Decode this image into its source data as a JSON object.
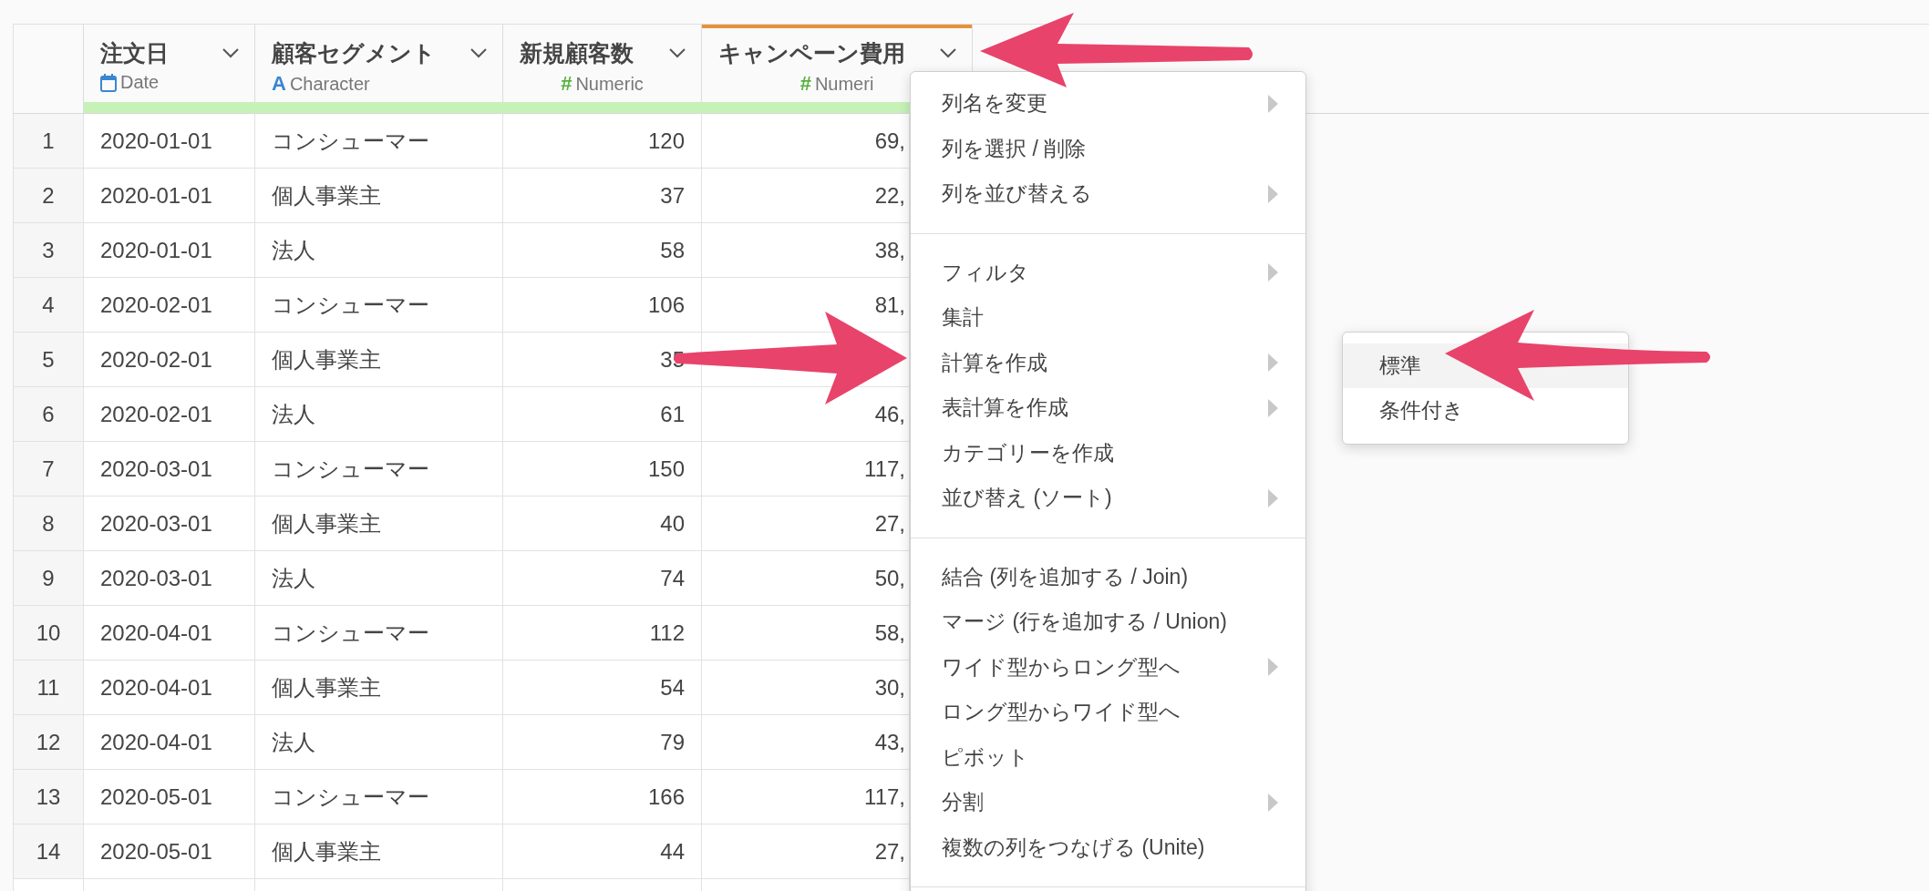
{
  "table": {
    "columns": [
      {
        "name": "注文日",
        "kind": "date",
        "type_label": "Date",
        "selected": false
      },
      {
        "name": "顧客セグメント",
        "kind": "character",
        "type_icon": "A",
        "type_label": "Character",
        "selected": false
      },
      {
        "name": "新規顧客数",
        "kind": "numeric",
        "type_icon": "#",
        "type_label": "Numeric",
        "selected": false
      },
      {
        "name": "キャンペーン費用",
        "kind": "numeric",
        "type_icon": "#",
        "type_label": "Numeri",
        "selected": true
      }
    ],
    "rows": [
      {
        "number": "1",
        "cells": [
          "2020-01-01",
          "コンシューマー",
          "120",
          "69,"
        ]
      },
      {
        "number": "2",
        "cells": [
          "2020-01-01",
          "個人事業主",
          "37",
          "22,"
        ]
      },
      {
        "number": "3",
        "cells": [
          "2020-01-01",
          "法人",
          "58",
          "38,"
        ]
      },
      {
        "number": "4",
        "cells": [
          "2020-02-01",
          "コンシューマー",
          "106",
          "81,"
        ]
      },
      {
        "number": "5",
        "cells": [
          "2020-02-01",
          "個人事業主",
          "35"
        ]
      },
      {
        "number": "6",
        "cells": [
          "2020-02-01",
          "法人",
          "61",
          "46,"
        ]
      },
      {
        "number": "7",
        "cells": [
          "2020-03-01",
          "コンシューマー",
          "150",
          "117,"
        ]
      },
      {
        "number": "8",
        "cells": [
          "2020-03-01",
          "個人事業主",
          "40",
          "27,"
        ]
      },
      {
        "number": "9",
        "cells": [
          "2020-03-01",
          "法人",
          "74",
          "50,"
        ]
      },
      {
        "number": "10",
        "cells": [
          "2020-04-01",
          "コンシューマー",
          "112",
          "58,"
        ]
      },
      {
        "number": "11",
        "cells": [
          "2020-04-01",
          "個人事業主",
          "54",
          "30,"
        ]
      },
      {
        "number": "12",
        "cells": [
          "2020-04-01",
          "法人",
          "79",
          "43,"
        ]
      },
      {
        "number": "13",
        "cells": [
          "2020-05-01",
          "コンシューマー",
          "166",
          "117,"
        ]
      },
      {
        "number": "14",
        "cells": [
          "2020-05-01",
          "個人事業主",
          "44",
          "27,"
        ]
      }
    ]
  },
  "context_menu": {
    "sections": [
      [
        {
          "label": "列名を変更",
          "has_submenu": true
        },
        {
          "label": "列を選択 / 削除",
          "has_submenu": false
        },
        {
          "label": "列を並び替える",
          "has_submenu": true
        }
      ],
      [
        {
          "label": "フィルタ",
          "has_submenu": true
        },
        {
          "label": "集計",
          "has_submenu": false
        },
        {
          "label": "計算を作成",
          "has_submenu": true
        },
        {
          "label": "表計算を作成",
          "has_submenu": true
        },
        {
          "label": "カテゴリーを作成",
          "has_submenu": false
        },
        {
          "label": "並び替え (ソート)",
          "has_submenu": true
        }
      ],
      [
        {
          "label": "結合 (列を追加する / Join)",
          "has_submenu": false
        },
        {
          "label": "マージ (行を追加する / Union)",
          "has_submenu": false
        },
        {
          "label": "ワイド型からロング型へ",
          "has_submenu": true
        },
        {
          "label": "ロング型からワイド型へ",
          "has_submenu": false
        },
        {
          "label": "ピボット",
          "has_submenu": false
        },
        {
          "label": "分割",
          "has_submenu": true
        },
        {
          "label": "複数の列をつなげる (Unite)",
          "has_submenu": false
        }
      ]
    ]
  },
  "submenu": {
    "items": [
      {
        "label": "標準",
        "selected": true
      },
      {
        "label": "条件付き",
        "selected": false
      }
    ]
  }
}
